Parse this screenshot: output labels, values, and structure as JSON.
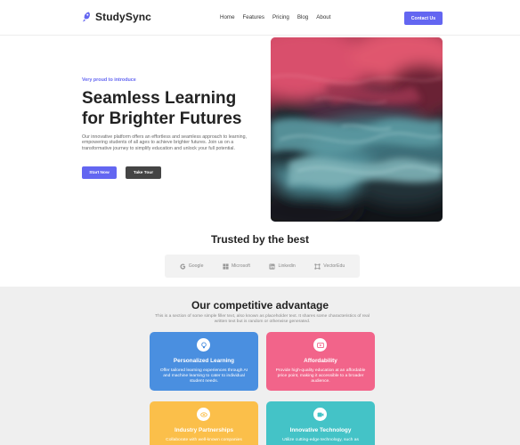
{
  "brand": {
    "name": "StudySync",
    "icon": "rocket-icon",
    "color": "#6366f1"
  },
  "nav": {
    "links": [
      "Home",
      "Features",
      "Pricing",
      "Blog",
      "About"
    ],
    "cta": "Contact Us"
  },
  "hero": {
    "eyebrow": "Very proud to introduce",
    "title_line1": "Seamless Learning",
    "title_line2": "for Brighter Futures",
    "description": "Our innovative platform offers an effortless and seamless approach to learning, empowering students of all ages to achieve brighter futures. Join us on a transformative journey to simplify education and unlock your full potential.",
    "primary_button": "Start Now",
    "secondary_button": "Take Tour"
  },
  "trusted": {
    "title": "Trusted by the best",
    "logos": [
      {
        "name": "Google",
        "icon": "google-icon"
      },
      {
        "name": "Microsoft",
        "icon": "microsoft-icon"
      },
      {
        "name": "Linkedin",
        "icon": "linkedin-icon"
      },
      {
        "name": "VectorEdu",
        "icon": "vectoredu-icon"
      }
    ]
  },
  "advantage": {
    "title": "Our competitive advantage",
    "subtitle": "This is a section of some simple filler text, also known as placeholder text. It shares some characteristics of real written text but is random or otherwise generated.",
    "cards": [
      {
        "title": "Personalized Learning",
        "text": "Offer tailored learning experiences through AI and machine learning to cater to individual student needs.",
        "icon": "lightbulb-icon",
        "color": "#4a8fe0"
      },
      {
        "title": "Affordability",
        "text": "Provide high-quality education at an affordable price point, making it accessible to a broader audience.",
        "icon": "play-icon",
        "color": "#f2648a"
      },
      {
        "title": "Industry Partnerships",
        "text": "Collaborate with well-known companies",
        "icon": "handshake-icon",
        "color": "#fbbf4a"
      },
      {
        "title": "Innovative Technology",
        "text": "Utilize cutting-edge technology, such as",
        "icon": "video-icon",
        "color": "#44c3c7"
      }
    ]
  }
}
